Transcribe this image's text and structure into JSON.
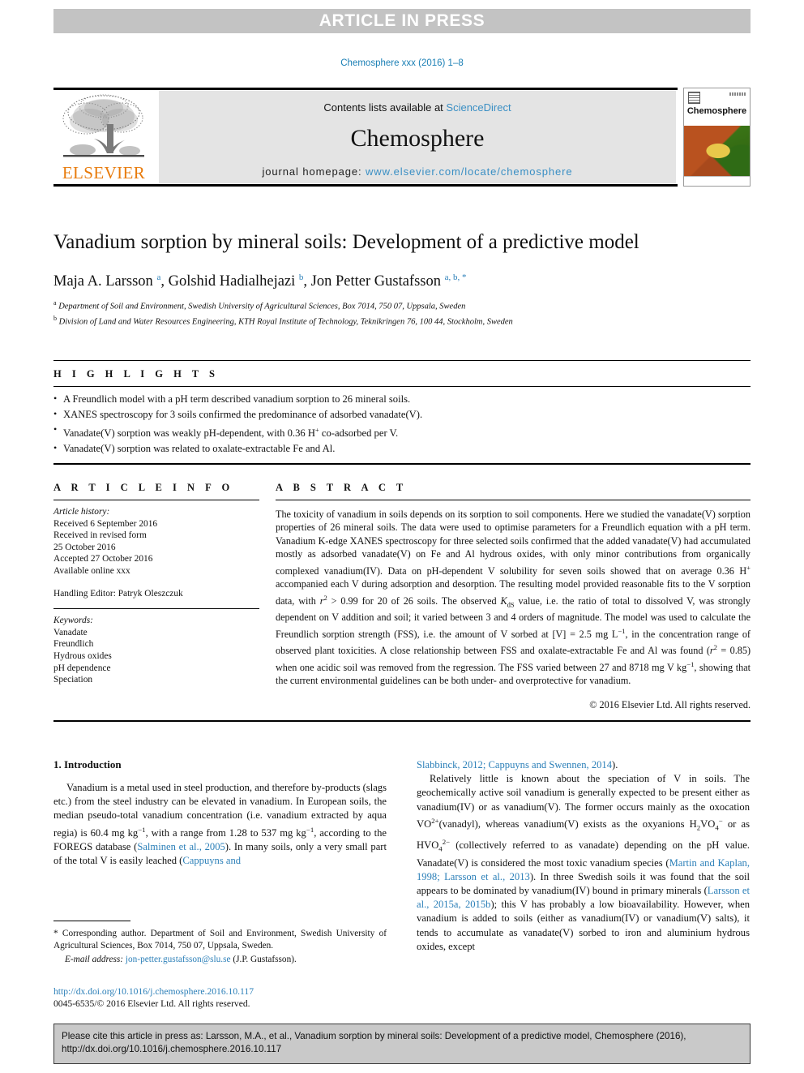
{
  "banner": {
    "text": "ARTICLE IN PRESS"
  },
  "running_head": {
    "text": "Chemosphere xxx (2016) 1–8"
  },
  "masthead": {
    "contents_prefix": "Contents lists available at ",
    "sciencedirect": "ScienceDirect",
    "journal_name": "Chemosphere",
    "homepage_prefix": "journal homepage: ",
    "homepage_url": "www.elsevier.com/locate/chemosphere",
    "publisher": "ELSEVIER",
    "cover_title": "Chemosphere",
    "link_color": "#3a8fc4",
    "publisher_color": "#e87b0c"
  },
  "article": {
    "title": "Vanadium sorption by mineral soils: Development of a predictive model",
    "authors_html": "Maja A. Larsson <sup>a</sup>, Golshid Hadialhejazi <sup>b</sup>, Jon Petter Gustafsson <sup>a, b, *</sup>",
    "affiliations": [
      {
        "marker": "a",
        "text": "Department of Soil and Environment, Swedish University of Agricultural Sciences, Box 7014, 750 07, Uppsala, Sweden"
      },
      {
        "marker": "b",
        "text": "Division of Land and Water Resources Engineering, KTH Royal Institute of Technology, Teknikringen 76, 100 44, Stockholm, Sweden"
      }
    ]
  },
  "highlights": {
    "label": "H I G H L I G H T S",
    "items": [
      "A Freundlich model with a pH term described vanadium sorption to 26 mineral soils.",
      "XANES spectroscopy for 3 soils confirmed the predominance of adsorbed vanadate(V).",
      "Vanadate(V) sorption was weakly pH-dependent, with 0.36 H<sup>+</sup> co-adsorbed per V.",
      "Vanadate(V) sorption was related to oxalate-extractable Fe and Al."
    ]
  },
  "article_info": {
    "label": "A R T I C L E  I N F O",
    "history_label": "Article history:",
    "history_lines": [
      "Received 6 September 2016",
      "Received in revised form",
      "25 October 2016",
      "Accepted 27 October 2016",
      "Available online xxx"
    ],
    "handling_editor": "Handling Editor: Patryk Oleszczuk",
    "keywords_label": "Keywords:",
    "keywords": [
      "Vanadate",
      "Freundlich",
      "Hydrous oxides",
      "pH dependence",
      "Speciation"
    ]
  },
  "abstract": {
    "label": "A B S T R A C T",
    "text_html": "The toxicity of vanadium in soils depends on its sorption to soil components. Here we studied the vanadate(V) sorption properties of 26 mineral soils. The data were used to optimise parameters for a Freundlich equation with a pH term. Vanadium K-edge XANES spectroscopy for three selected soils confirmed that the added vanadate(V) had accumulated mostly as adsorbed vanadate(V) on Fe and Al hydrous oxides, with only minor contributions from organically complexed vanadium(IV). Data on pH-dependent V solubility for seven soils showed that on average 0.36 H<sup>+</sup> accompanied each V during adsorption and desorption. The resulting model provided reasonable fits to the V sorption data, with <i>r</i><sup>2</sup> &gt; 0.99 for 20 of 26 soils. The observed <i>K</i><sub>dS</sub> value, i.e. the ratio of total to dissolved V, was strongly dependent on V addition and soil; it varied between 3 and 4 orders of magnitude. The model was used to calculate the Freundlich sorption strength (FSS), i.e. the amount of V sorbed at [V] = 2.5 mg L<sup>−1</sup>, in the concentration range of observed plant toxicities. A close relationship between FSS and oxalate-extractable Fe and Al was found (<i>r</i><sup>2</sup> = 0.85) when one acidic soil was removed from the regression. The FSS varied between 27 and 8718 mg V kg<sup>−1</sup>, showing that the current environmental guidelines can be both under- and overprotective for vanadium.",
    "copyright": "© 2016 Elsevier Ltd. All rights reserved."
  },
  "introduction": {
    "heading": "1. Introduction",
    "left_paragraph_html": "Vanadium is a metal used in steel production, and therefore by-products (slags etc.) from the steel industry can be elevated in vanadium. In European soils, the median pseudo-total vanadium concentration (i.e. vanadium extracted by aqua regia) is 60.4 mg kg<sup>−1</sup>, with a range from 1.28 to 537 mg kg<sup>−1</sup>, according to the FOREGS database (<span class=\"ref\">Salminen et al., 2005</span>). In many soils, only a very small part of the total V is easily leached (<span class=\"ref\">Cappuyns and</span>",
    "right_continuation_html": "<span class=\"ref\">Slabbinck, 2012; Cappuyns and Swennen, 2014</span>).",
    "right_paragraph_html": "Relatively little is known about the speciation of V in soils. The geochemically active soil vanadium is generally expected to be present either as vanadium(IV) or as vanadium(V). The former occurs mainly as the oxocation VO<sup>2+</sup>(vanadyl), whereas vanadium(V) exists as the oxyanions H<sub>2</sub>VO<sub>4</sub><sup>−</sup> or as HVO<sub>4</sub><sup>2−</sup> (collectively referred to as vanadate) depending on the pH value. Vanadate(V) is considered the most toxic vanadium species (<span class=\"ref\">Martin and Kaplan, 1998; Larsson et al., 2013</span>). In three Swedish soils it was found that the soil appears to be dominated by vanadium(IV) bound in primary minerals (<span class=\"ref\">Larsson et al., 2015a, 2015b</span>); this V has probably a low bioavailability. However, when vanadium is added to soils (either as vanadium(IV) or vanadium(V) salts), it tends to accumulate as vanadate(V) sorbed to iron and aluminium hydrous oxides, except"
  },
  "footnote": {
    "corresponding_html": "* Corresponding author. Department of Soil and Environment, Swedish University of Agricultural Sciences, Box 7014, 750 07, Uppsala, Sweden.",
    "email_label": "E-mail address:",
    "email": "jon-petter.gustafsson@slu.se",
    "email_suffix": "(J.P. Gustafsson)."
  },
  "doi_block": {
    "doi_url": "http://dx.doi.org/10.1016/j.chemosphere.2016.10.117",
    "issn_line": "0045-6535/© 2016 Elsevier Ltd. All rights reserved."
  },
  "cite_box": {
    "text": "Please cite this article in press as: Larsson, M.A., et al., Vanadium sorption by mineral soils: Development of a predictive model, Chemosphere (2016), http://dx.doi.org/10.1016/j.chemosphere.2016.10.117"
  }
}
